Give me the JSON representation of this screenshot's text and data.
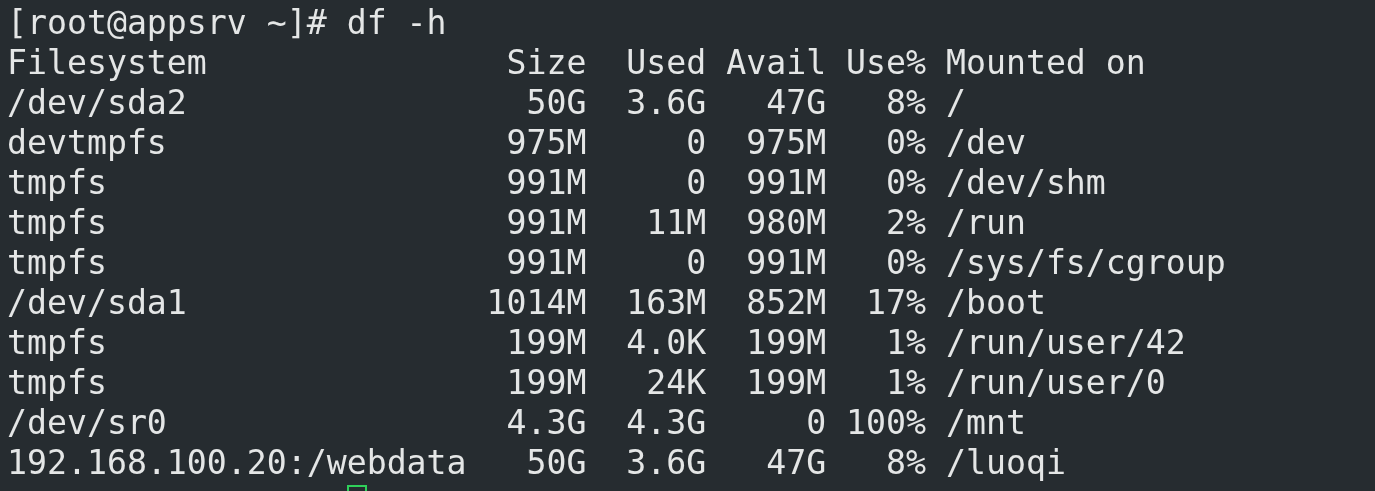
{
  "terminal": {
    "prompt_line": "[root@appsrv ~]# df -h",
    "columns": [
      "Filesystem",
      "Size",
      "Used",
      "Avail",
      "Use%",
      "Mounted on"
    ],
    "rows": [
      [
        "/dev/sda2",
        "50G",
        "3.6G",
        "47G",
        "8%",
        "/"
      ],
      [
        "devtmpfs",
        "975M",
        "0",
        "975M",
        "0%",
        "/dev"
      ],
      [
        "tmpfs",
        "991M",
        "0",
        "991M",
        "0%",
        "/dev/shm"
      ],
      [
        "tmpfs",
        "991M",
        "11M",
        "980M",
        "2%",
        "/run"
      ],
      [
        "tmpfs",
        "991M",
        "0",
        "991M",
        "0%",
        "/sys/fs/cgroup"
      ],
      [
        "/dev/sda1",
        "1014M",
        "163M",
        "852M",
        "17%",
        "/boot"
      ],
      [
        "tmpfs",
        "199M",
        "4.0K",
        "199M",
        "1%",
        "/run/user/42"
      ],
      [
        "tmpfs",
        "199M",
        "24K",
        "199M",
        "1%",
        "/run/user/0"
      ],
      [
        "/dev/sr0",
        "4.3G",
        "4.3G",
        "0",
        "100%",
        "/mnt"
      ],
      [
        "192.168.100.20:/webdata",
        "50G",
        "3.6G",
        "47G",
        "8%",
        "/luoqi"
      ]
    ]
  }
}
